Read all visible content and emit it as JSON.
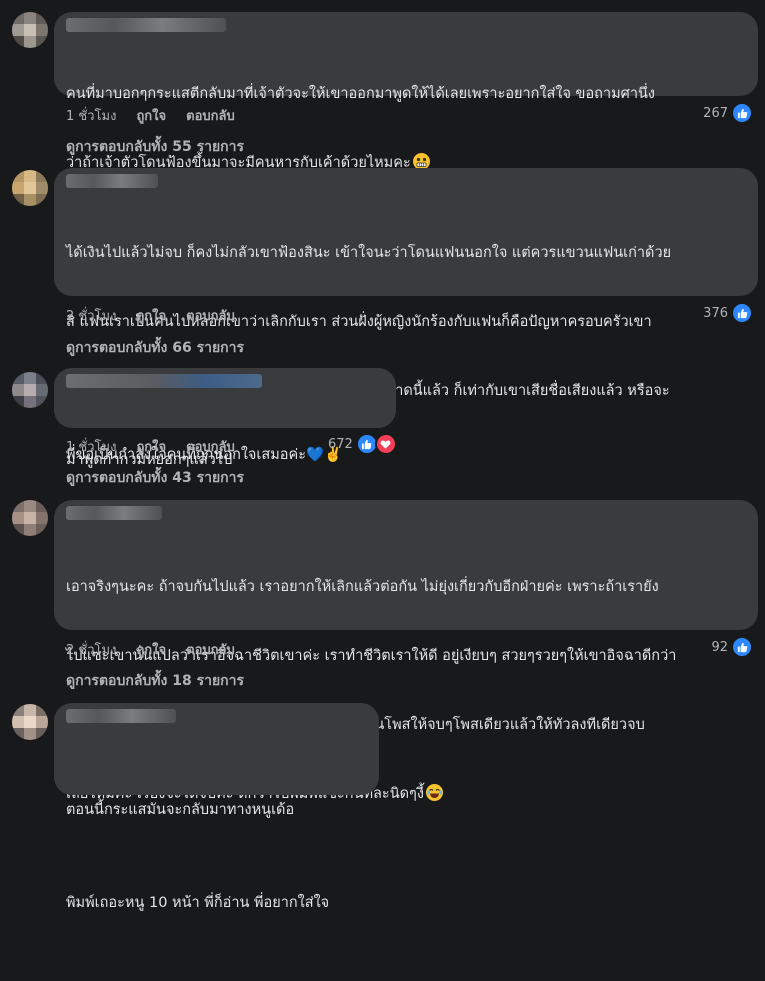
{
  "colors": {
    "background": "#18191a",
    "bubble": "#3a3b3c",
    "text": "#e4e6eb",
    "muted": "#b0b3b8",
    "like": "#2d88ff",
    "love": "#f33e58"
  },
  "comments": [
    {
      "lines": [
        "คนที่มาบอกๆกระแสตีกลับมาที่เจ้าตัวจะให้เขาออกมาพูดให้ได้เลยเพราะอยากใส่ใจ ขอถามศานึ่ง",
        "ว่าถ้าเจ้าตัวโดนฟ้องขึ้นมาจะมีคนหารกับเค้าด้วยไหมคะ"
      ],
      "emoji": "grimace-emoji",
      "time": "1 ชั่วโมง",
      "like_label": "ถูกใจ",
      "reply_label": "ตอบกลับ",
      "reaction_count": "267",
      "reactions": [
        "like"
      ],
      "view_replies": "ดูการตอบกลับทั้ง 55 รายการ"
    },
    {
      "lines": [
        "ได้เงินไปแล้วไม่จบ ก็คงไม่กลัวเขาฟ้องสินะ เข้าใจนะว่าโดนแฟนนอกใจ แต่ควรแขวนแฟนเก่าด้วย",
        "สิ แฟนเราเป็นคนไปหลอกเขาว่าเลิกกับเรา ส่วนฝั่งผู้หญิงนักร้องกับแฟนก็คือปัญหาครอบครัวเขา",
        "แล้ว หรือถ้ามันมีมากกว่านั้น ก็เปิดมาสิ ไหนๆก็เปิดขนาดนี้แล้ว ก็เท่ากับเขาเสียชื่อเสียงแล้ว หรือจะ",
        "มาพูดกำกวมหยอกๆแล้วไป"
      ],
      "emoji": "",
      "time": "2 ชั่วโมง",
      "like_label": "ถูกใจ",
      "reply_label": "ตอบกลับ",
      "reaction_count": "376",
      "reactions": [
        "like"
      ],
      "view_replies": "ดูการตอบกลับทั้ง 66 รายการ"
    },
    {
      "lines": [
        "พี่ขอเป็นกำลังใจคนที่ถูกนอกใจเสมอค่ะ💙✌️"
      ],
      "emoji": "",
      "time": "1 ชั่วโมง",
      "like_label": "ถูกใจ",
      "reply_label": "ตอบกลับ",
      "reaction_count": "672",
      "reactions": [
        "like",
        "love"
      ],
      "view_replies": "ดูการตอบกลับทั้ง 43 รายการ"
    },
    {
      "lines": [
        "เอาจริงๆนะคะ ถ้าจบกันไปแล้ว เราอยากให้เลิกแล้วต่อกัน ไม่ยุ่งเกี่ยวกับอีกฝ่ายค่ะ เพราะถ้าเรายัง",
        "ไปแซะเขานั่นแปลว่าเราอิจฉาชีวิตเขาค่ะ เราทำชีวิตเราให้ดี อยู่เงียบๆ สวยๆรวยๆให้เขาอิจฉาดีกว่า",
        "ค่ะ แต่ถ้าเราต้องการที่จะแฉเขา เราพิมพ์อธิบายเป็นโพสให้จบๆโพสเดียวแล้วให้ทัวลงทีเดียวจบ",
        "เลยไหมคะ เรื่องจะได้จบค่ะ ดีกว่าไปพิมพ์แซะกันทีละนิดๆงี้"
      ],
      "emoji": "laugh-emoji",
      "time": "2 ชั่วโมง",
      "like_label": "ถูกใจ",
      "reply_label": "ตอบกลับ",
      "reaction_count": "92",
      "reactions": [
        "like"
      ],
      "view_replies": "ดูการตอบกลับทั้ง 18 รายการ"
    },
    {
      "lines": [
        "ตอนนี้กระแสมันจะกลับมาทางหนูเด้อ",
        "พิมพ์เถอะหนู 10 หน้า พี่ก็อ่าน พี่อยากใส่ใจ"
      ],
      "emoji": "",
      "time": "",
      "like_label": "",
      "reply_label": "",
      "reaction_count": "",
      "reactions": [],
      "view_replies": ""
    }
  ]
}
